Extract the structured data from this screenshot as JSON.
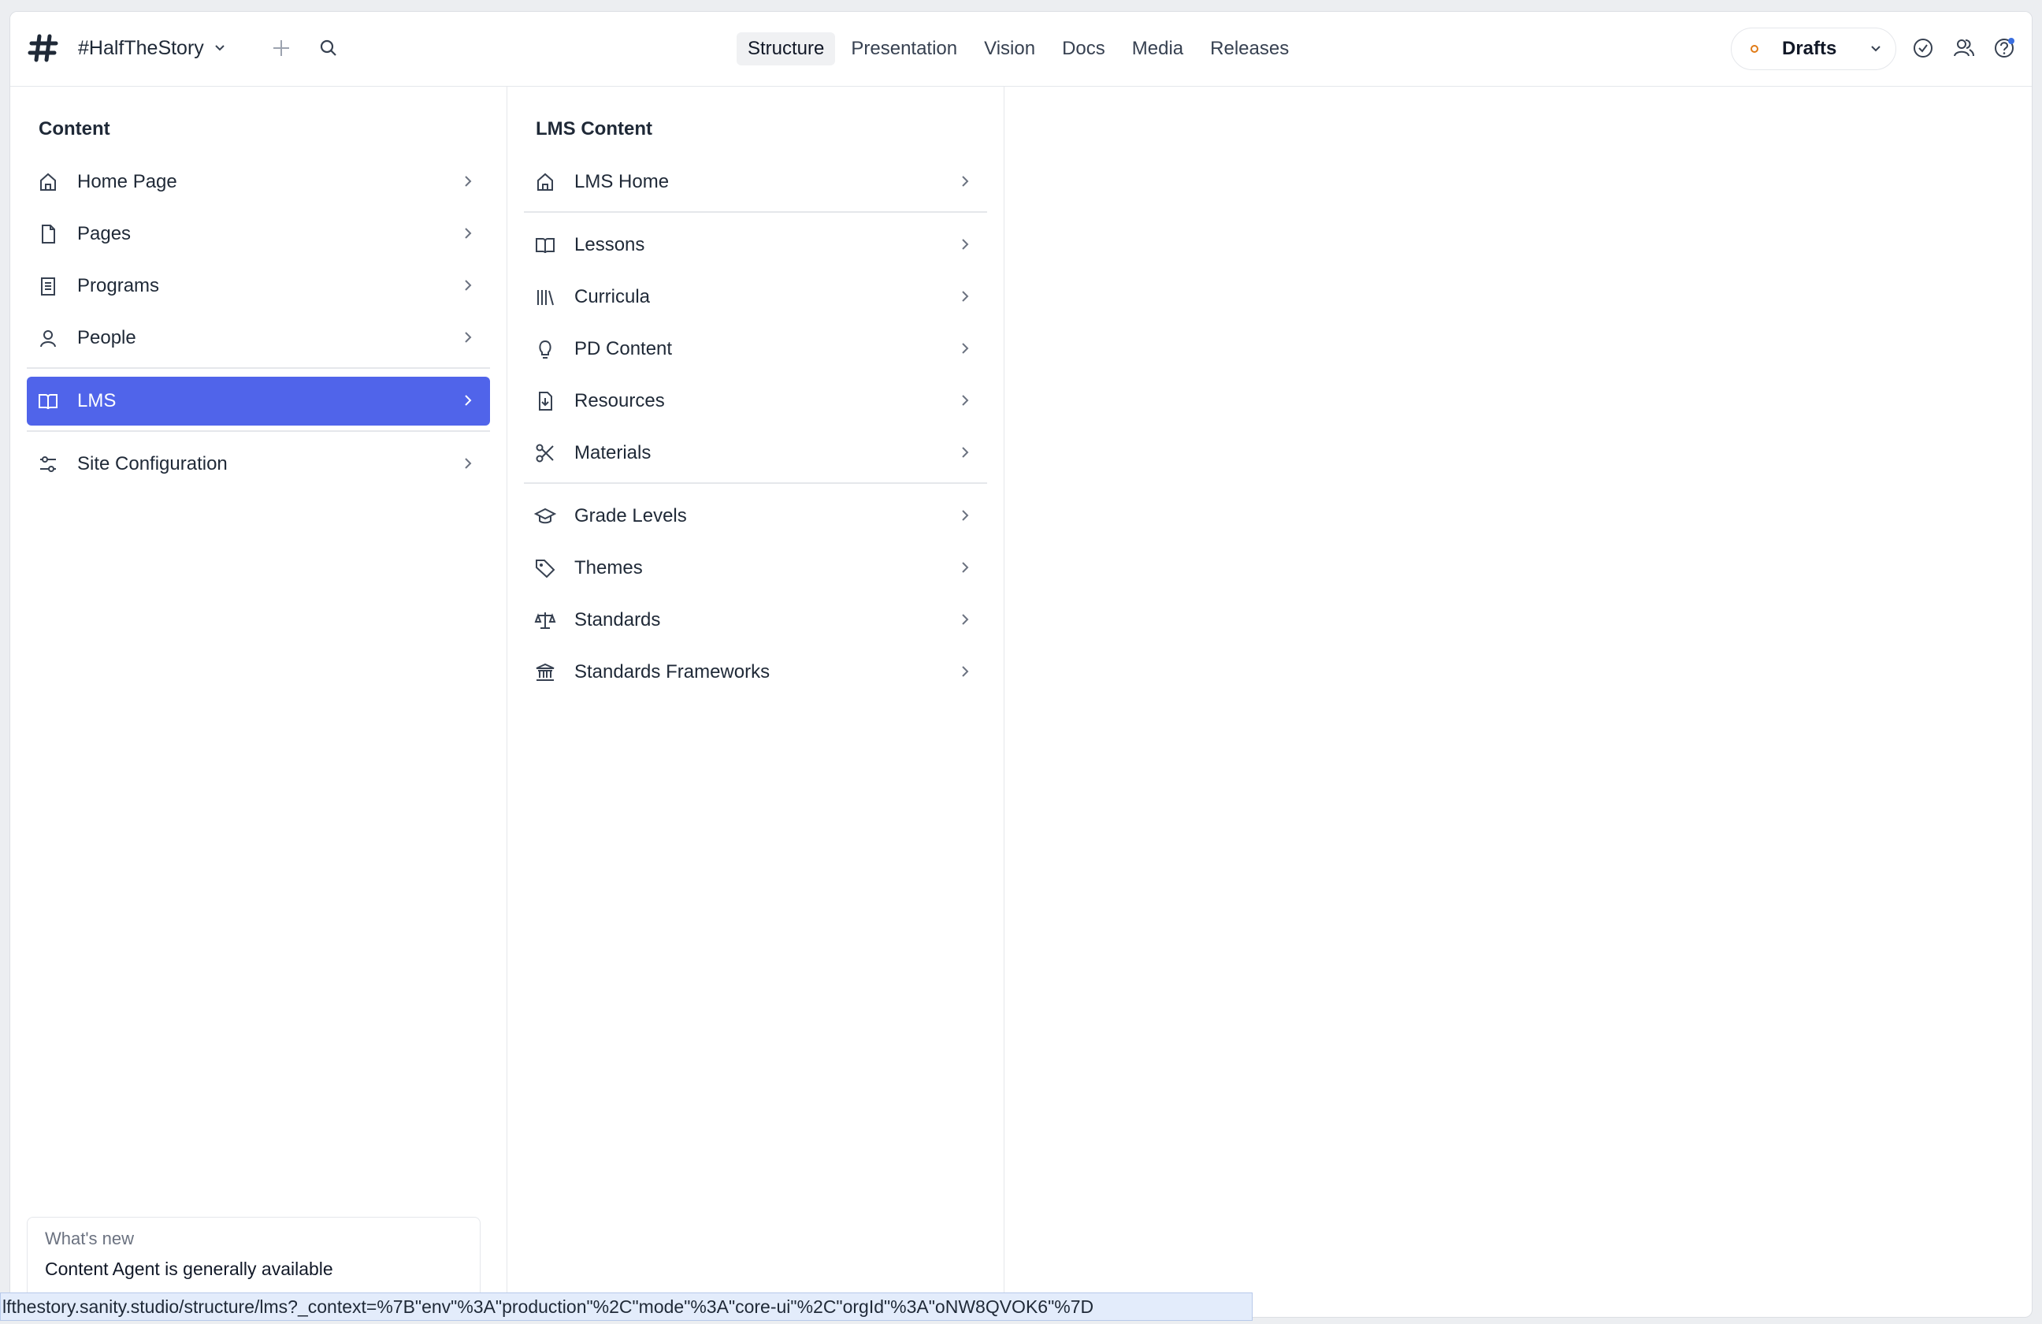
{
  "workspace": {
    "name": "#HalfTheStory"
  },
  "nav": {
    "items": [
      "Structure",
      "Presentation",
      "Vision",
      "Docs",
      "Media",
      "Releases"
    ],
    "active": "Structure"
  },
  "drafts": {
    "label": "Drafts",
    "status_color": "#e07b17"
  },
  "icons": {
    "logo": "hash-icon",
    "add": "plus-icon",
    "search": "search-icon",
    "tasks": "check-circle-icon",
    "presence": "users-icon",
    "help": "help-icon"
  },
  "pane1": {
    "title": "Content",
    "items": [
      {
        "label": "Home Page",
        "icon": "home-icon"
      },
      {
        "label": "Pages",
        "icon": "document-icon"
      },
      {
        "label": "Programs",
        "icon": "list-doc-icon"
      },
      {
        "label": "People",
        "icon": "user-icon"
      },
      {
        "label": "LMS",
        "icon": "book-icon",
        "selected": true
      },
      {
        "label": "Site Configuration",
        "icon": "controls-icon"
      }
    ]
  },
  "pane2": {
    "title": "LMS Content",
    "items": [
      {
        "label": "LMS Home",
        "icon": "home-icon"
      },
      {
        "label": "Lessons",
        "icon": "book-icon"
      },
      {
        "label": "Curricula",
        "icon": "library-icon"
      },
      {
        "label": "PD Content",
        "icon": "bulb-icon"
      },
      {
        "label": "Resources",
        "icon": "download-doc-icon"
      },
      {
        "label": "Materials",
        "icon": "scissors-icon"
      },
      {
        "label": "Grade Levels",
        "icon": "graduation-cap-icon"
      },
      {
        "label": "Themes",
        "icon": "tag-icon"
      },
      {
        "label": "Standards",
        "icon": "scale-icon"
      },
      {
        "label": "Standards Frameworks",
        "icon": "bank-icon"
      }
    ]
  },
  "whats_new": {
    "heading": "What's new",
    "text": "Content Agent is generally available"
  },
  "status_url": "lfthestory.sanity.studio/structure/lms?_context=%7B\"env\"%3A\"production\"%2C\"mode\"%3A\"core-ui\"%2C\"orgId\"%3A\"oNW8QVOK6\"%7D",
  "colors": {
    "accent": "#5064ea"
  }
}
